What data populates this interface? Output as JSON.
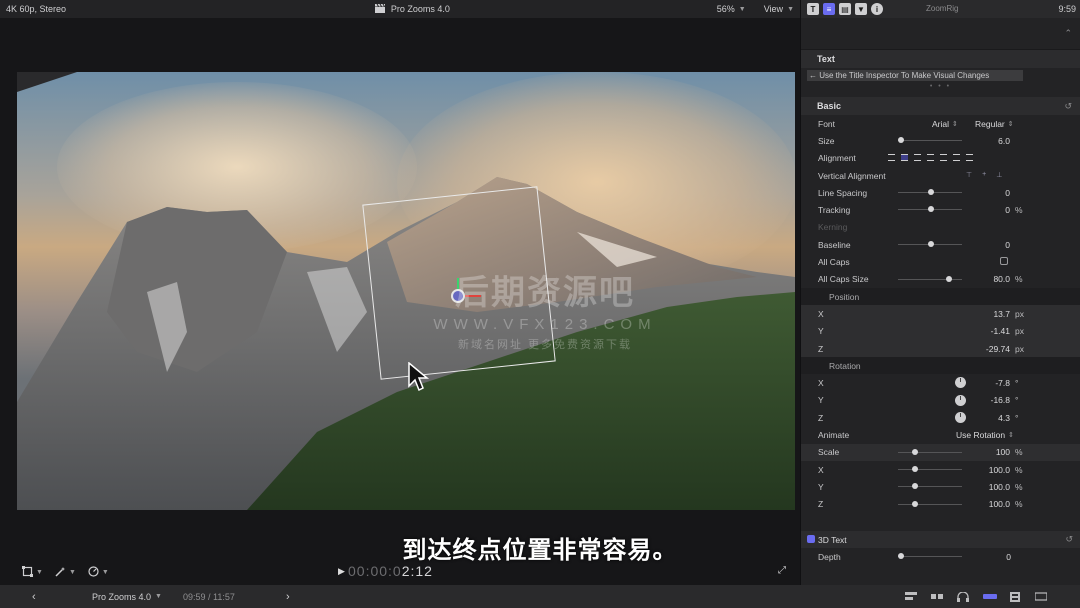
{
  "viewer": {
    "format": "4K 60p, Stereo",
    "project_title": "Pro Zooms 4.0",
    "zoom": "56%",
    "view_label": "View",
    "timecode_dim": "00:00:0",
    "timecode_end": "2:12",
    "watermark": {
      "line1": "后期资源吧",
      "line2": "WWW.VFX123.COM",
      "line3": "新域名网址 更多免费资源下载"
    }
  },
  "subtitle": "到达终点位置非常容易。",
  "bottombar": {
    "project_name": "Pro Zooms 4.0",
    "duration": "09:59 / 11:57"
  },
  "inspector": {
    "clip_name": "ZoomRig",
    "time": "9:59",
    "text_section": {
      "title": "Text",
      "field_value": "← Use the Title Inspector To Make Visual Changes"
    },
    "basic": {
      "title": "Basic",
      "font_label": "Font",
      "font_family": "Arial",
      "font_style": "Regular",
      "size_label": "Size",
      "size_value": "6.0",
      "alignment_label": "Alignment",
      "vertical_alignment_label": "Vertical Alignment",
      "line_spacing_label": "Line Spacing",
      "line_spacing_value": "0",
      "tracking_label": "Tracking",
      "tracking_value": "0",
      "tracking_unit": "%",
      "kerning_label": "Kerning",
      "baseline_label": "Baseline",
      "baseline_value": "0",
      "all_caps_label": "All Caps",
      "all_caps_size_label": "All Caps Size",
      "all_caps_size_value": "80.0",
      "all_caps_size_unit": "%",
      "position_label": "Position",
      "position": [
        {
          "axis": "X",
          "value": "13.7",
          "unit": "px"
        },
        {
          "axis": "Y",
          "value": "-1.41",
          "unit": "px"
        },
        {
          "axis": "Z",
          "value": "-29.74",
          "unit": "px"
        }
      ],
      "rotation_label": "Rotation",
      "rotation": [
        {
          "axis": "X",
          "value": "-7.8",
          "unit": "°"
        },
        {
          "axis": "Y",
          "value": "-16.8",
          "unit": "°"
        },
        {
          "axis": "Z",
          "value": "4.3",
          "unit": "°"
        }
      ],
      "animate_label": "Animate",
      "animate_value": "Use Rotation",
      "scale_label": "Scale",
      "scale_value": "100",
      "scale_unit": "%",
      "scale_axes": [
        {
          "axis": "X",
          "value": "100.0",
          "unit": "%"
        },
        {
          "axis": "Y",
          "value": "100.0",
          "unit": "%"
        },
        {
          "axis": "Z",
          "value": "100.0",
          "unit": "%"
        }
      ]
    },
    "threed": {
      "title": "3D Text",
      "depth_label": "Depth",
      "depth_value": "0"
    }
  },
  "colors": {
    "accent": "#6a6cf0",
    "panel": "#232325",
    "background": "#1b1b1d"
  }
}
